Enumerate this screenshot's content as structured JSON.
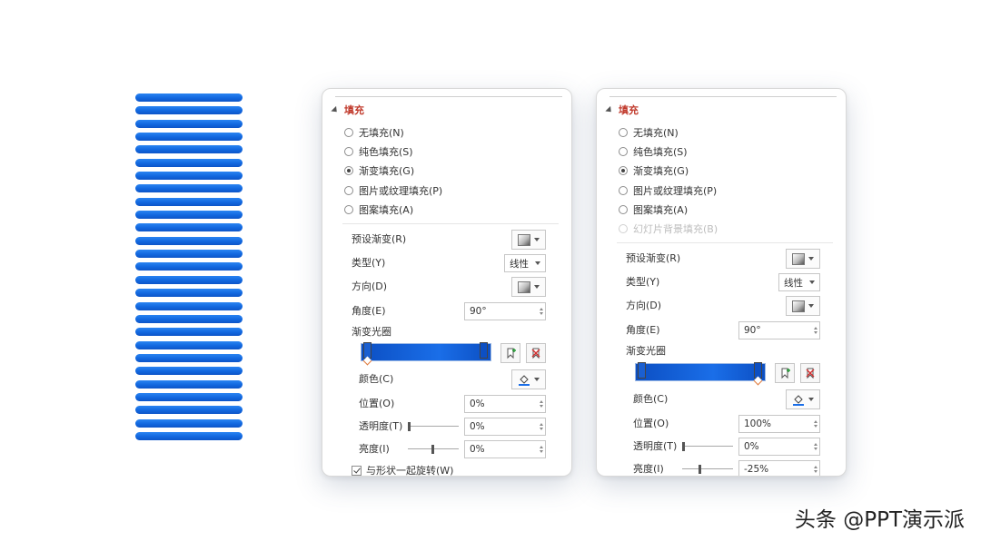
{
  "left_graphic": {
    "stripe_count": 27,
    "stripe_color": "#1268df"
  },
  "panels": {
    "left": {
      "section_title": "填充",
      "fill_options": [
        "无填充(N)",
        "纯色填充(S)",
        "渐变填充(G)",
        "图片或纹理填充(P)",
        "图案填充(A)"
      ],
      "selected_option": "渐变填充(G)",
      "preset_label": "预设渐变(R)",
      "type_label": "类型(Y)",
      "type_value": "线性",
      "direction_label": "方向(D)",
      "angle_label": "角度(E)",
      "angle_value": "90°",
      "stops_label": "渐变光圈",
      "color_label": "颜色(C)",
      "position_label": "位置(O)",
      "position_value": "0%",
      "transparency_label": "透明度(T)",
      "transparency_value": "0%",
      "brightness_label": "亮度(I)",
      "brightness_value": "0%",
      "rotate_label": "与形状一起旋转(W)",
      "rotate_checked": true
    },
    "right": {
      "section_title": "填充",
      "fill_options": [
        "无填充(N)",
        "纯色填充(S)",
        "渐变填充(G)",
        "图片或纹理填充(P)",
        "图案填充(A)"
      ],
      "disabled_option": "幻灯片背景填充(B)",
      "selected_option": "渐变填充(G)",
      "preset_label": "预设渐变(R)",
      "type_label": "类型(Y)",
      "type_value": "线性",
      "direction_label": "方向(D)",
      "angle_label": "角度(E)",
      "angle_value": "90°",
      "stops_label": "渐变光圈",
      "color_label": "颜色(C)",
      "position_label": "位置(O)",
      "position_value": "100%",
      "transparency_label": "透明度(T)",
      "transparency_value": "0%",
      "brightness_label": "亮度(I)",
      "brightness_value": "-25%"
    }
  },
  "watermark": "头条 @PPT演示派",
  "icons": {
    "add_stop": "add-gradient-stop-icon",
    "remove_stop": "remove-gradient-stop-icon",
    "paint_bucket": "paint-bucket-icon",
    "gradient_preview": "gradient-preview-icon"
  },
  "colors": {
    "accent_title": "#c0392b",
    "gradient_blue": "#1a6ee8"
  }
}
